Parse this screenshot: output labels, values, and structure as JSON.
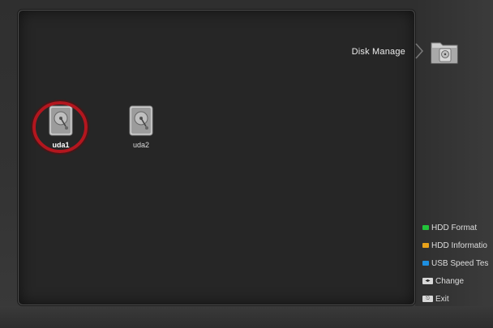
{
  "menu": {
    "title": "Disk Manage"
  },
  "disks": [
    {
      "label": "uda1",
      "selected": true
    },
    {
      "label": "uda2",
      "selected": false
    }
  ],
  "legend": [
    {
      "color": "#22c43a",
      "icon": "green-key-icon",
      "label": "HDD Format"
    },
    {
      "color": "#e8a21a",
      "icon": "yellow-key-icon",
      "label": "HDD Informatio"
    },
    {
      "color": "#1e8fe0",
      "icon": "blue-key-icon",
      "label": "USB Speed Tes"
    },
    {
      "icon": "ok-key-icon",
      "label": "Change"
    },
    {
      "icon": "exit-key-icon",
      "label": "Exit"
    }
  ],
  "colors": {
    "focus_ring": "#b3161e",
    "panel": "#262626"
  }
}
